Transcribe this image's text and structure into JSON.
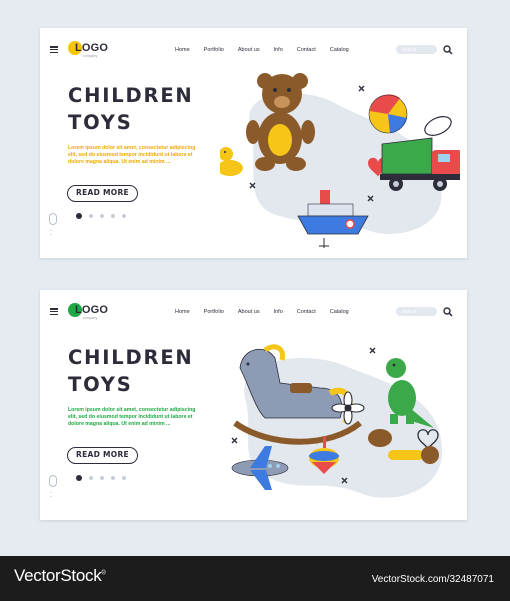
{
  "cards": [
    {
      "logo": {
        "text": "LOGO",
        "sub": "company",
        "color": "#f7c600"
      },
      "nav": [
        "Home",
        "Portfolio",
        "About us",
        "Info",
        "Contact",
        "Catalog"
      ],
      "search_placeholder": "Search...",
      "title_line1": "CHILDREN",
      "title_line2": "TOYS",
      "body": "Lorem ipsum dolor sit amet, consectetur adipiscing elit, sed do eiusmod tempor incididunt ut labore et dolore magna aliqua. Ut enim ad minim ...",
      "body_color": "#f0a800",
      "cta": "READ MORE",
      "pager": {
        "count": 5,
        "active": 0
      },
      "illustration_icons": [
        "teddy-bear-icon",
        "beach-ball-icon",
        "rubber-duck-icon",
        "dump-truck-icon",
        "toy-boat-icon",
        "heart-icon",
        "leaf-icon"
      ]
    },
    {
      "logo": {
        "text": "LOGO",
        "sub": "company",
        "color": "#1fa843"
      },
      "nav": [
        "Home",
        "Portfolio",
        "About us",
        "Info",
        "Contact",
        "Catalog"
      ],
      "search_placeholder": "Search...",
      "title_line1": "CHILDREN",
      "title_line2": "TOYS",
      "body": "Lorem ipsum dolor sit amet, consectetur adipiscing elit, sed do eiusmod tempor incididunt ut labore et dolore magna aliqua. Ut enim ad minim ...",
      "body_color": "#1fa843",
      "cta": "READ MORE",
      "pager": {
        "count": 5,
        "active": 0
      },
      "illustration_icons": [
        "rocking-horse-icon",
        "dinosaur-icon",
        "flower-icon",
        "spinning-top-icon",
        "airplane-icon",
        "toy-dog-icon",
        "heart-icon"
      ]
    }
  ],
  "watermark": {
    "brand": "VectorStock",
    "reg": "®",
    "id": "VectorStock.com/32487071"
  }
}
